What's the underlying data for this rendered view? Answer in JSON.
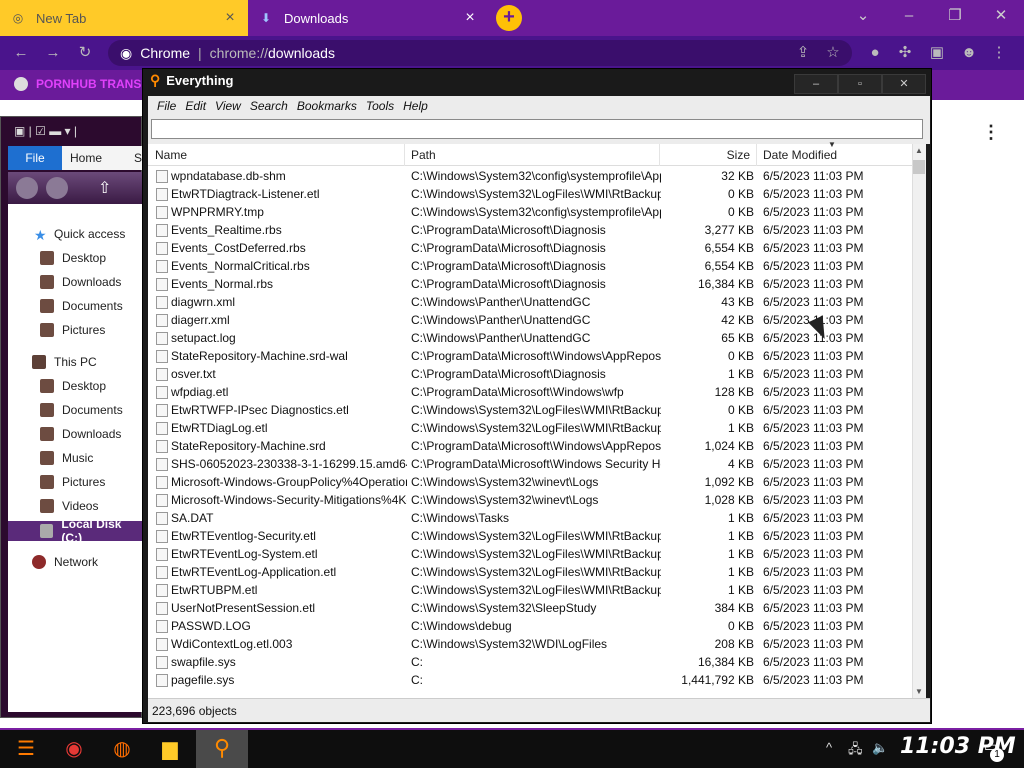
{
  "browser": {
    "tabs": [
      {
        "label": "New Tab",
        "icon": "chrome-icon"
      },
      {
        "label": "Downloads",
        "icon": "download-icon"
      }
    ],
    "omnibox": {
      "site": "Chrome",
      "scheme": "chrome://",
      "host": "downloads"
    },
    "bookmark": "PORNHUB TRANS",
    "colors": {
      "tabstrip": "#6a1b9a",
      "active_tab": "#ffca28",
      "toolbar": "#4a148c"
    }
  },
  "explorer": {
    "ribbon": {
      "file": "File",
      "home": "Home",
      "share_partial": "S"
    },
    "nav": [
      {
        "label": "Quick access",
        "icon": "star-icon"
      },
      {
        "label": "Desktop",
        "icon": "desktop-icon"
      },
      {
        "label": "Downloads",
        "icon": "downloads-icon"
      },
      {
        "label": "Documents",
        "icon": "documents-icon"
      },
      {
        "label": "Pictures",
        "icon": "pictures-icon"
      },
      {
        "label": "This PC",
        "icon": "computer-icon"
      },
      {
        "label": "Desktop",
        "icon": "desktop-icon"
      },
      {
        "label": "Documents",
        "icon": "documents-icon"
      },
      {
        "label": "Downloads",
        "icon": "downloads-icon"
      },
      {
        "label": "Music",
        "icon": "music-icon"
      },
      {
        "label": "Pictures",
        "icon": "pictures-icon"
      },
      {
        "label": "Videos",
        "icon": "videos-icon"
      },
      {
        "label": "Local Disk (C:)",
        "icon": "drive-icon"
      },
      {
        "label": "Network",
        "icon": "network-icon"
      }
    ]
  },
  "everything": {
    "title": "Everything",
    "menu": [
      "File",
      "Edit",
      "View",
      "Search",
      "Bookmarks",
      "Tools",
      "Help"
    ],
    "search_value": "",
    "columns": {
      "name": "Name",
      "path": "Path",
      "size": "Size",
      "date": "Date Modified"
    },
    "rows": [
      [
        "wpndatabase.db-shm",
        "C:\\Windows\\System32\\config\\systemprofile\\App...",
        "32 KB",
        "6/5/2023 11:03 PM"
      ],
      [
        "EtwRTDiagtrack-Listener.etl",
        "C:\\Windows\\System32\\LogFiles\\WMI\\RtBackup",
        "0 KB",
        "6/5/2023 11:03 PM"
      ],
      [
        "WPNPRMRY.tmp",
        "C:\\Windows\\System32\\config\\systemprofile\\App...",
        "0 KB",
        "6/5/2023 11:03 PM"
      ],
      [
        "Events_Realtime.rbs",
        "C:\\ProgramData\\Microsoft\\Diagnosis",
        "3,277 KB",
        "6/5/2023 11:03 PM"
      ],
      [
        "Events_CostDeferred.rbs",
        "C:\\ProgramData\\Microsoft\\Diagnosis",
        "6,554 KB",
        "6/5/2023 11:03 PM"
      ],
      [
        "Events_NormalCritical.rbs",
        "C:\\ProgramData\\Microsoft\\Diagnosis",
        "6,554 KB",
        "6/5/2023 11:03 PM"
      ],
      [
        "Events_Normal.rbs",
        "C:\\ProgramData\\Microsoft\\Diagnosis",
        "16,384 KB",
        "6/5/2023 11:03 PM"
      ],
      [
        "diagwrn.xml",
        "C:\\Windows\\Panther\\UnattendGC",
        "43 KB",
        "6/5/2023 11:03 PM"
      ],
      [
        "diagerr.xml",
        "C:\\Windows\\Panther\\UnattendGC",
        "42 KB",
        "6/5/2023 11:03 PM"
      ],
      [
        "setupact.log",
        "C:\\Windows\\Panther\\UnattendGC",
        "65 KB",
        "6/5/2023 11:03 PM"
      ],
      [
        "StateRepository-Machine.srd-wal",
        "C:\\ProgramData\\Microsoft\\Windows\\AppRepository",
        "0 KB",
        "6/5/2023 11:03 PM"
      ],
      [
        "osver.txt",
        "C:\\ProgramData\\Microsoft\\Diagnosis",
        "1 KB",
        "6/5/2023 11:03 PM"
      ],
      [
        "wfpdiag.etl",
        "C:\\ProgramData\\Microsoft\\Windows\\wfp",
        "128 KB",
        "6/5/2023 11:03 PM"
      ],
      [
        "EtwRTWFP-IPsec Diagnostics.etl",
        "C:\\Windows\\System32\\LogFiles\\WMI\\RtBackup",
        "0 KB",
        "6/5/2023 11:03 PM"
      ],
      [
        "EtwRTDiagLog.etl",
        "C:\\Windows\\System32\\LogFiles\\WMI\\RtBackup",
        "1 KB",
        "6/5/2023 11:03 PM"
      ],
      [
        "StateRepository-Machine.srd",
        "C:\\ProgramData\\Microsoft\\Windows\\AppRepository",
        "1,024 KB",
        "6/5/2023 11:03 PM"
      ],
      [
        "SHS-06052023-230338-3-1-16299.15.amd64f...",
        "C:\\ProgramData\\Microsoft\\Windows Security Heal...",
        "4 KB",
        "6/5/2023 11:03 PM"
      ],
      [
        "Microsoft-Windows-GroupPolicy%4Operational...",
        "C:\\Windows\\System32\\winevt\\Logs",
        "1,092 KB",
        "6/5/2023 11:03 PM"
      ],
      [
        "Microsoft-Windows-Security-Mitigations%4Kern...",
        "C:\\Windows\\System32\\winevt\\Logs",
        "1,028 KB",
        "6/5/2023 11:03 PM"
      ],
      [
        "SA.DAT",
        "C:\\Windows\\Tasks",
        "1 KB",
        "6/5/2023 11:03 PM"
      ],
      [
        "EtwRTEventlog-Security.etl",
        "C:\\Windows\\System32\\LogFiles\\WMI\\RtBackup",
        "1 KB",
        "6/5/2023 11:03 PM"
      ],
      [
        "EtwRTEventLog-System.etl",
        "C:\\Windows\\System32\\LogFiles\\WMI\\RtBackup",
        "1 KB",
        "6/5/2023 11:03 PM"
      ],
      [
        "EtwRTEventLog-Application.etl",
        "C:\\Windows\\System32\\LogFiles\\WMI\\RtBackup",
        "1 KB",
        "6/5/2023 11:03 PM"
      ],
      [
        "EtwRTUBPM.etl",
        "C:\\Windows\\System32\\LogFiles\\WMI\\RtBackup",
        "1 KB",
        "6/5/2023 11:03 PM"
      ],
      [
        "UserNotPresentSession.etl",
        "C:\\Windows\\System32\\SleepStudy",
        "384 KB",
        "6/5/2023 11:03 PM"
      ],
      [
        "PASSWD.LOG",
        "C:\\Windows\\debug",
        "0 KB",
        "6/5/2023 11:03 PM"
      ],
      [
        "WdiContextLog.etl.003",
        "C:\\Windows\\System32\\WDI\\LogFiles",
        "208 KB",
        "6/5/2023 11:03 PM"
      ],
      [
        "swapfile.sys",
        "C:",
        "16,384 KB",
        "6/5/2023 11:03 PM"
      ],
      [
        "pagefile.sys",
        "C:",
        "1,441,792 KB",
        "6/5/2023 11:03 PM"
      ]
    ],
    "status": "223,696 objects"
  },
  "taskbar": {
    "clock": "11:03 PM",
    "notification_count": "1",
    "apps": [
      "start-icon",
      "chrome-icon",
      "firefox-icon",
      "file-explorer-icon",
      "everything-icon"
    ],
    "accent": "#7a1fa2"
  }
}
